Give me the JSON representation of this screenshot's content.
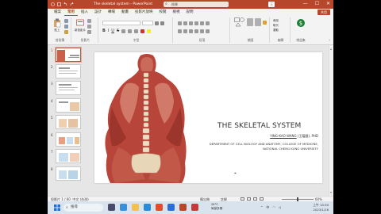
{
  "window": {
    "title": "The skeletal system - PowerPoint",
    "search_placeholder": "搜尋",
    "user_label": "王",
    "minimize": "—",
    "maximize": "☐",
    "close": "✕"
  },
  "tabs": [
    {
      "label": "檔案"
    },
    {
      "label": "常用"
    },
    {
      "label": "插入"
    },
    {
      "label": "設計"
    },
    {
      "label": "轉場"
    },
    {
      "label": "動畫"
    },
    {
      "label": "投影片放映"
    },
    {
      "label": "校閱"
    },
    {
      "label": "檢視"
    },
    {
      "label": "說明"
    }
  ],
  "share_label": "共用",
  "ribbon": {
    "groups": [
      {
        "label": "剪貼簿"
      },
      {
        "label": "投影片"
      },
      {
        "label": "字型"
      },
      {
        "label": "段落"
      },
      {
        "label": "繪圖"
      },
      {
        "label": "編輯"
      },
      {
        "label": "增益集"
      }
    ],
    "paste_label": "貼上",
    "new_slide_label": "新投影片",
    "find_label": "尋找",
    "replace_label": "取代",
    "select_label": "選取"
  },
  "thumbnails": [
    {
      "num": "1"
    },
    {
      "num": "2"
    },
    {
      "num": "3"
    },
    {
      "num": "4"
    },
    {
      "num": "5"
    },
    {
      "num": "6"
    },
    {
      "num": "7"
    },
    {
      "num": "8"
    }
  ],
  "slide": {
    "title": "THE SKELETAL SYSTEM",
    "author_name": "YING-KAO WANG",
    "author_cjk": " (王蔭國), PHD",
    "dept_line1": "DEPARTMENT OF CELL BIOLOGY AND ANATOMY, COLLEGE OF MEDICINE,",
    "dept_line2": "NATIONAL CHENG KUNG UNIVERSITY"
  },
  "status": {
    "slide_info": "投影片 1 / 60",
    "language": "中文 (台灣)",
    "notes_label": "備忘稿",
    "comments_label": "註解",
    "zoom": "60%"
  },
  "taskbar": {
    "search_label": "搜尋",
    "weather_temp": "26°C",
    "weather_desc": "局部多雲",
    "time": "上午 10:30",
    "date": "2023/1/16",
    "ime": "中"
  },
  "colors": {
    "accent": "#b7472a",
    "ribbon_bg": "#f3f3f3",
    "taskbar_bg": "#d8e3ee"
  }
}
